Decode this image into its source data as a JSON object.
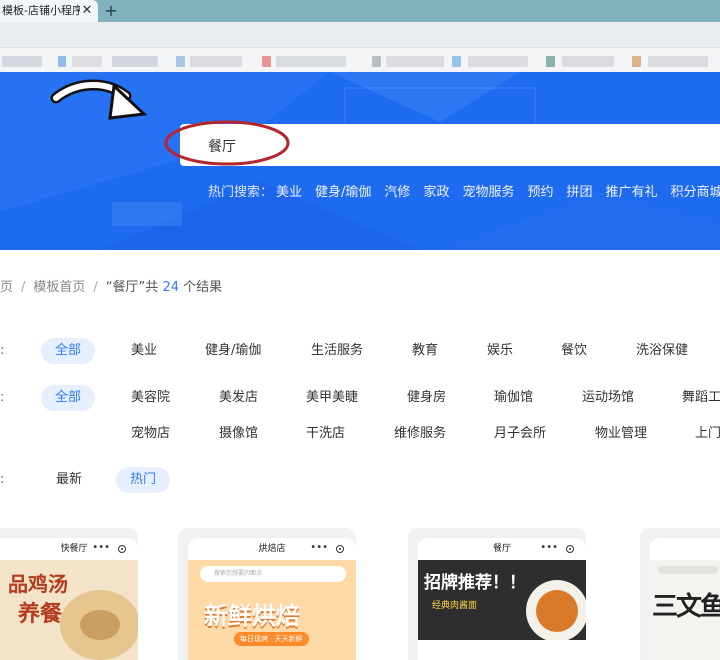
{
  "browser": {
    "tab_title": "模板-店铺小程序",
    "close_glyph": "✕",
    "new_tab_glyph": "+"
  },
  "search": {
    "value": "餐厅"
  },
  "hot_search": {
    "label": "热门搜索：",
    "items": [
      "美业",
      "健身/瑜伽",
      "汽修",
      "家政",
      "宠物服务",
      "预约",
      "拼团",
      "推广有礼",
      "积分商城"
    ]
  },
  "breadcrumb": {
    "item1": "页",
    "sep": "/",
    "item2": "模板首页",
    "query": "“餐厅”",
    "total_prefix": "共",
    "count": "24",
    "total_suffix": "个结果"
  },
  "filters": {
    "colon": ":",
    "industry": [
      "全部",
      "美业",
      "健身/瑜伽",
      "生活服务",
      "教育",
      "娱乐",
      "餐饮",
      "洗浴保健"
    ],
    "sub_row1": [
      "全部",
      "美容院",
      "美发店",
      "美甲美睫",
      "健身房",
      "瑜伽馆",
      "运动场馆",
      "舞蹈工"
    ],
    "sub_row2": [
      "宠物店",
      "摄像馆",
      "干洗店",
      "维修服务",
      "月子会所",
      "物业管理",
      "上门"
    ],
    "sort": [
      "最新",
      "热门"
    ]
  },
  "cards": [
    {
      "title": "快餐厅",
      "poster_line1": "品鸡汤",
      "poster_line2": "养餐"
    },
    {
      "title": "烘焙店",
      "search_hint": "搜索您想要的面点",
      "poster_line1": "新鲜烘焙",
      "poster_tag": "每日现烤 · 天天新鲜"
    },
    {
      "title": "餐厅",
      "poster_line1": "招牌推荐！！",
      "poster_tag": "经典肉酱面"
    },
    {
      "title": "",
      "poster_line1": "三文鱼"
    }
  ],
  "card_menu_glyph": "•••",
  "colors": {
    "hero_blue": "#1f6bf0",
    "accent": "#2f7bff",
    "chip_bg": "#e6efff",
    "annotation_red": "#b5262f"
  },
  "icons": [
    "arrow-annotation-icon",
    "close-icon",
    "plus-icon",
    "capsule-dot-icon"
  ]
}
